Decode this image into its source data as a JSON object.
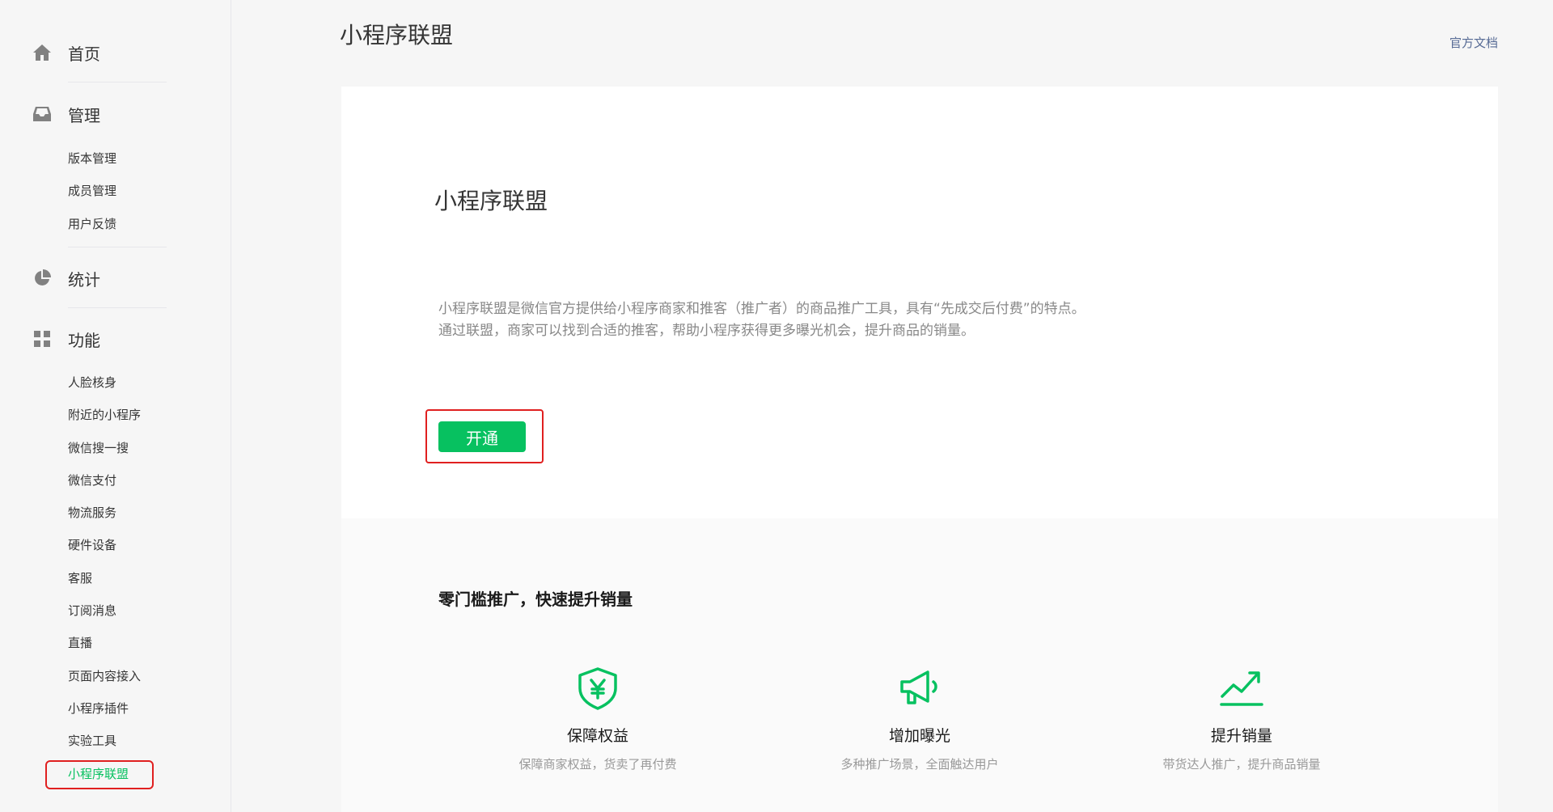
{
  "sidebar": {
    "home": {
      "label": "首页",
      "icon": "home-icon"
    },
    "manage": {
      "label": "管理",
      "icon": "inbox-icon",
      "items": [
        "版本管理",
        "成员管理",
        "用户反馈"
      ]
    },
    "stats": {
      "label": "统计",
      "icon": "pie-chart-icon"
    },
    "features": {
      "label": "功能",
      "icon": "grid-icon",
      "items": [
        "人脸核身",
        "附近的小程序",
        "微信搜一搜",
        "微信支付",
        "物流服务",
        "硬件设备",
        "客服",
        "订阅消息",
        "直播",
        "页面内容接入",
        "小程序插件",
        "实验工具",
        "小程序联盟"
      ],
      "active_item": "小程序联盟"
    }
  },
  "header": {
    "title": "小程序联盟",
    "doc_link": "官方文档"
  },
  "intro": {
    "title": "小程序联盟",
    "desc_line1": "小程序联盟是微信官方提供给小程序商家和推客（推广者）的商品推广工具，具有“先成交后付费”的特点。",
    "desc_line2": "通过联盟，商家可以找到合适的推客，帮助小程序获得更多曝光机会，提升商品的销量。",
    "open_button": "开通"
  },
  "benefits": {
    "title": "零门槛推广，快速提升销量",
    "items": [
      {
        "name": "保障权益",
        "desc": "保障商家权益，货卖了再付费",
        "icon": "shield-yen-icon"
      },
      {
        "name": "增加曝光",
        "desc": "多种推广场景，全面触达用户",
        "icon": "megaphone-icon"
      },
      {
        "name": "提升销量",
        "desc": "带货达人推广，提升商品销量",
        "icon": "trend-up-icon"
      }
    ]
  },
  "colors": {
    "accent": "#07c160",
    "link": "#576b95",
    "annotation": "#e02020"
  }
}
